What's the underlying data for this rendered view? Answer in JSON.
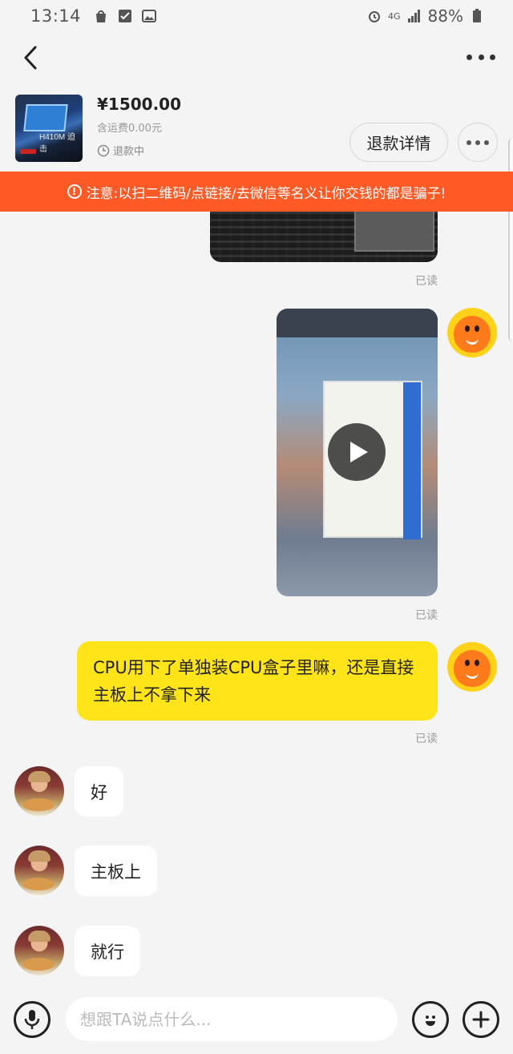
{
  "status_bar": {
    "time": "13:14",
    "battery": "88%",
    "network": "4G"
  },
  "product": {
    "thumb_text": "H410M 迫击",
    "price": "¥1500.00",
    "shipping": "含运费0.00元",
    "status": "退款中",
    "refund_button": "退款详情"
  },
  "warning": {
    "text": "注意:以扫二维码/点链接/去微信等名义让你交钱的都是骗子!"
  },
  "messages": {
    "read_1": "已读",
    "read_2": "已读",
    "read_3": "已读",
    "me_text": "CPU用下了单独装CPU盒子里嘛，还是直接主板上不拿下来",
    "other_1": "好",
    "other_2": "主板上",
    "other_3": "就行"
  },
  "input": {
    "placeholder": "想跟TA说点什么..."
  },
  "colors": {
    "accent": "#ff5a26",
    "bubble_me": "#ffe419"
  }
}
